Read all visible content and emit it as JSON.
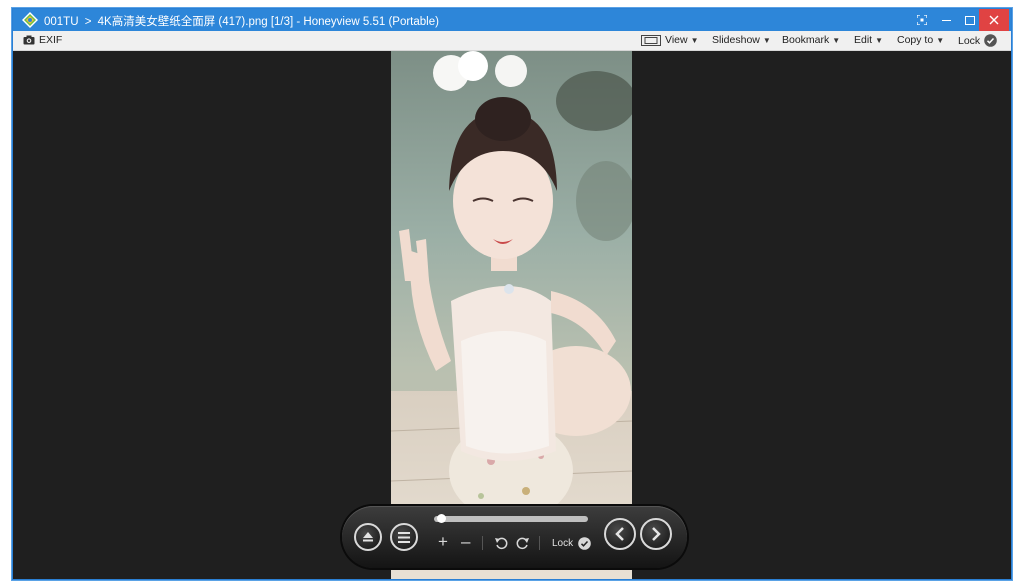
{
  "window": {
    "folder": "001TU",
    "separator": ">",
    "file_title": "4K高清美女壁纸全面屏 (417).png [1/3] - Honeyview 5.51 (Portable)",
    "accent_color": "#2d86d9",
    "close_color": "#e04343"
  },
  "toolbar": {
    "exif_label": "EXIF",
    "view_label": "View",
    "slideshow_label": "Slideshow",
    "bookmark_label": "Bookmark",
    "edit_label": "Edit",
    "copyto_label": "Copy to",
    "lock_label": "Lock"
  },
  "controls": {
    "lock_label": "Lock",
    "progress": 0.02,
    "icons": [
      "eject-icon",
      "menu-icon",
      "zoom-in-icon",
      "zoom-out-icon",
      "rotate-left-icon",
      "rotate-right-icon",
      "lock-check-icon",
      "previous-icon",
      "next-icon"
    ]
  },
  "image": {
    "description_icon": "photo"
  }
}
